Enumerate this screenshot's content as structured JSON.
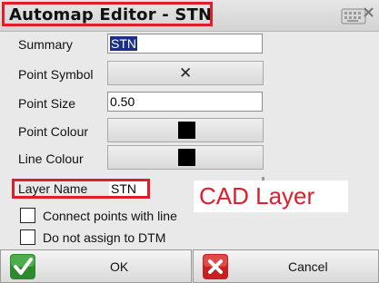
{
  "window": {
    "title": "Automap Editor - STN"
  },
  "form": {
    "summary": {
      "label": "Summary",
      "value": "STN"
    },
    "point_symbol": {
      "label": "Point Symbol",
      "symbol": "✕"
    },
    "point_size": {
      "label": "Point Size",
      "value": "0.50"
    },
    "point_colour": {
      "label": "Point Colour",
      "color": "#000000"
    },
    "line_colour": {
      "label": "Line Colour",
      "color": "#000000"
    },
    "layer_name": {
      "label": "Layer Name",
      "value": "STN"
    }
  },
  "annotation": {
    "cad_layer": "CAD Layer",
    "highlight_color": "#e11d2b"
  },
  "options": [
    {
      "label": "Connect points with line",
      "checked": false
    },
    {
      "label": "Do not assign to DTM",
      "checked": false
    }
  ],
  "footer": {
    "ok": {
      "label": "OK",
      "icon": "check-icon"
    },
    "cancel": {
      "label": "Cancel",
      "icon": "x-icon"
    }
  }
}
